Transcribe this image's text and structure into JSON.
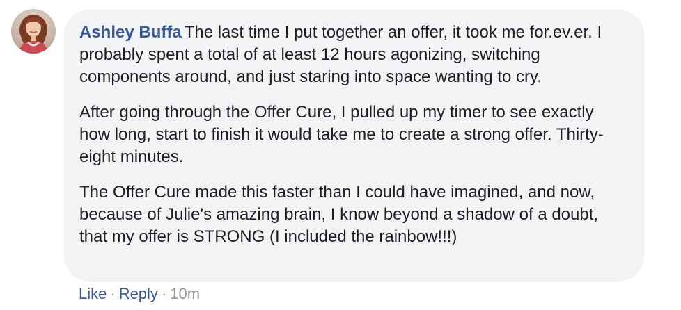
{
  "comment": {
    "author_name": "Ashley Buffa",
    "paragraphs": [
      "The last time I put together an offer, it took me for.ev.er. I probably spent a total of at least 12 hours agonizing, switching components around, and just staring into space wanting to cry.",
      "After going through the Offer Cure, I pulled up my timer to see exactly how long, start to finish it would take me to create a strong offer. Thirty-eight minutes.",
      "The Offer Cure made this faster than I could have imagined, and now, because of Julie's amazing brain, I know beyond a shadow of a doubt, that my offer is STRONG (I included the rainbow!!!)"
    ],
    "avatar_icon": "user-avatar-photo"
  },
  "actions": {
    "like_label": "Like",
    "reply_label": "Reply",
    "separator": "·",
    "timestamp": "10m"
  },
  "colors": {
    "author_blue": "#385898",
    "bubble_bg": "#f2f3f5",
    "text": "#1c1e21",
    "meta_gray": "#90949c"
  }
}
